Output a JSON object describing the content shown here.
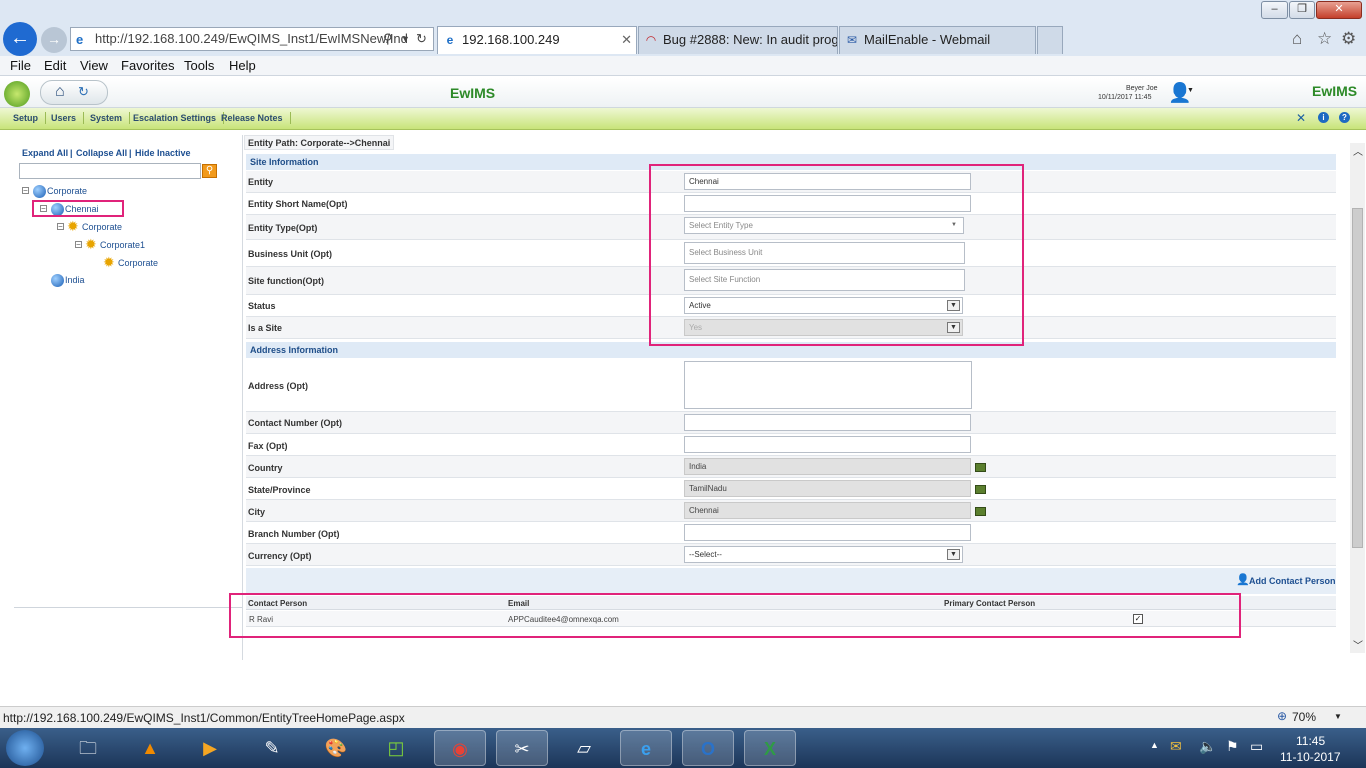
{
  "browser": {
    "address": "http://192.168.100.249/EwQIMS_Inst1/EwIMSNew/Ind",
    "tabs": [
      {
        "label": "192.168.100.249"
      },
      {
        "label": "Bug #2888: New: In audit progr..."
      },
      {
        "label": "MailEnable - Webmail"
      }
    ],
    "menu": [
      "File",
      "Edit",
      "View",
      "Favorites",
      "Tools",
      "Help"
    ],
    "status_url": "http://192.168.100.249/EwQIMS_Inst1/Common/EntityTreeHomePage.aspx",
    "zoom": "70%"
  },
  "app": {
    "logo": "EwIMS",
    "logo_right": "EwIMS",
    "user_name": "Beyer Joe",
    "user_datetime": "10/11/2017 11:45",
    "nav": [
      "Setup",
      "Users",
      "System",
      "Escalation Settings",
      "Release Notes"
    ]
  },
  "tree": {
    "links": [
      "Expand All",
      "Collapse All",
      "Hide Inactive"
    ],
    "nodes": [
      "Corporate",
      "Chennai",
      "Corporate",
      "Corporate1",
      "Corporate",
      "India"
    ]
  },
  "form": {
    "entity_path": "Entity Path: Corporate-->Chennai",
    "site_section": "Site Information",
    "address_section": "Address Information",
    "labels": {
      "entity": "Entity",
      "short_name": "Entity Short Name(Opt)",
      "entity_type": "Entity Type(Opt)",
      "business_unit": "Business Unit (Opt)",
      "site_function": "Site function(Opt)",
      "status": "Status",
      "is_site": "Is a Site",
      "address": "Address (Opt)",
      "contact_number": "Contact Number (Opt)",
      "fax": "Fax (Opt)",
      "country": "Country",
      "state": "State/Province",
      "city": "City",
      "branch": "Branch Number (Opt)",
      "currency": "Currency (Opt)"
    },
    "values": {
      "entity": "Chennai",
      "entity_type_placeholder": "Select Entity Type",
      "business_unit_placeholder": "Select Business Unit",
      "site_function_placeholder": "Select Site Function",
      "status": "Active",
      "is_site": "Yes",
      "country": "India",
      "state": "TamilNadu",
      "city": "Chennai",
      "currency": "--Select--"
    },
    "add_contact": "Add Contact Person",
    "contact_headers": [
      "Contact Person",
      "Email",
      "Primary Contact Person"
    ],
    "contacts": [
      {
        "name": "R Ravi",
        "email": "APPCauditee4@omnexqa.com"
      }
    ]
  },
  "taskbar": {
    "time": "11:45",
    "date": "11-10-2017"
  }
}
